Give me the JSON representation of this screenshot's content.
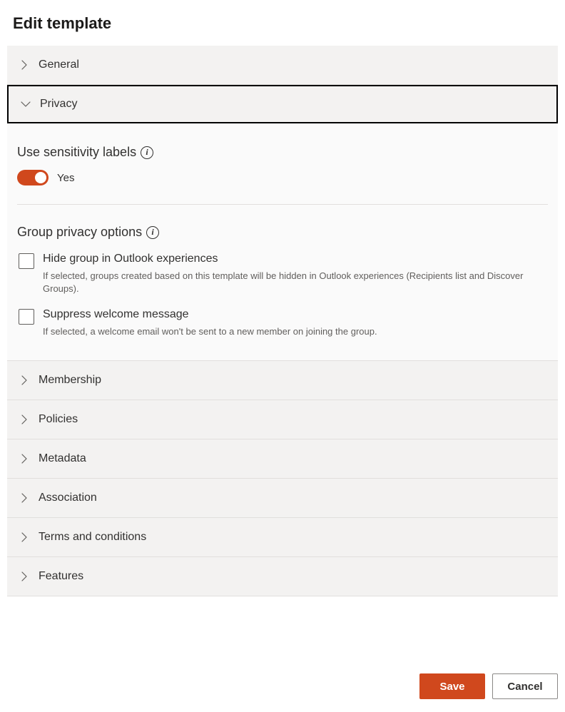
{
  "title": "Edit template",
  "sections": {
    "general": {
      "label": "General",
      "expanded": false
    },
    "privacy": {
      "label": "Privacy",
      "expanded": true,
      "sensitivity": {
        "title": "Use sensitivity labels",
        "toggle_on": true,
        "toggle_text": "Yes"
      },
      "group_privacy": {
        "title": "Group privacy options",
        "options": [
          {
            "checked": false,
            "label": "Hide group in Outlook experiences",
            "description": "If selected, groups created based on this template will be hidden in Outlook experiences (Recipients list and Discover Groups)."
          },
          {
            "checked": false,
            "label": "Suppress welcome message",
            "description": "If selected, a welcome email won't be sent to a new member on joining the group."
          }
        ]
      }
    },
    "membership": {
      "label": "Membership",
      "expanded": false
    },
    "policies": {
      "label": "Policies",
      "expanded": false
    },
    "metadata": {
      "label": "Metadata",
      "expanded": false
    },
    "association": {
      "label": "Association",
      "expanded": false
    },
    "terms": {
      "label": "Terms and conditions",
      "expanded": false
    },
    "features": {
      "label": "Features",
      "expanded": false
    }
  },
  "buttons": {
    "save": "Save",
    "cancel": "Cancel"
  }
}
